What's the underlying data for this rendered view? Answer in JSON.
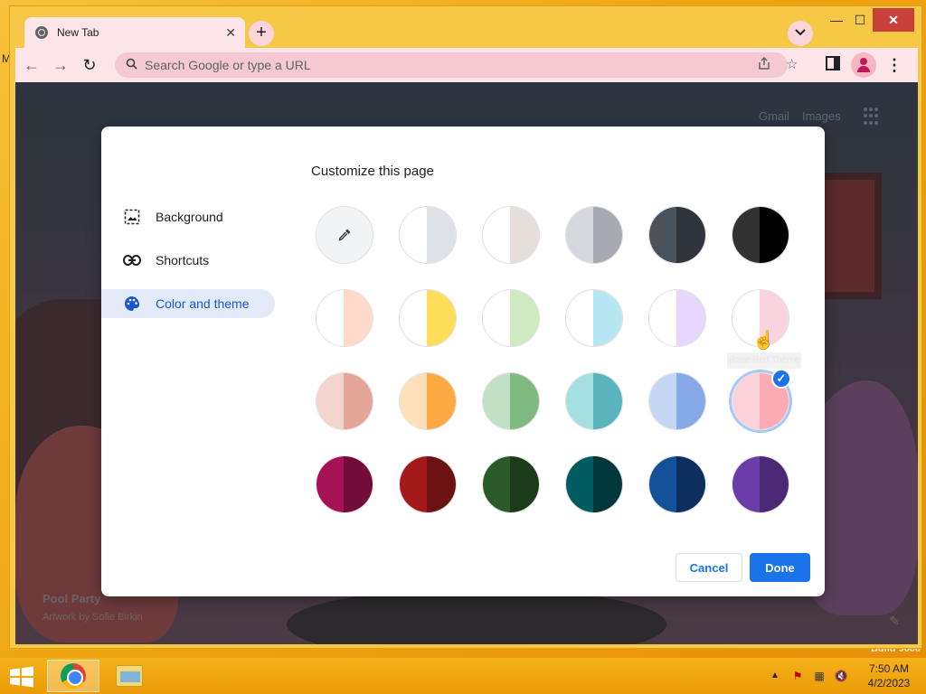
{
  "desktop": {
    "letter": "M",
    "build_text": "Build 9600"
  },
  "browser": {
    "tab": {
      "title": "New Tab",
      "close": "✕"
    },
    "newtab": "+",
    "window": {
      "minimize": "—",
      "maximize": "☐",
      "close": "✕"
    },
    "toolbar": {
      "back": "←",
      "forward": "→",
      "reload": "↻",
      "menu": "⋮"
    },
    "omnibox": {
      "placeholder": "Search Google or type a URL",
      "value": ""
    }
  },
  "ntp": {
    "links": {
      "gmail": "Gmail",
      "images": "Images"
    },
    "artwork": {
      "title": "Pool Party",
      "credit": "Artwork by Sofie Birkin"
    }
  },
  "dialog": {
    "title": "Customize this page",
    "sidebar": [
      {
        "label": "Background",
        "icon": "image-icon",
        "selected": false
      },
      {
        "label": "Shortcuts",
        "icon": "link-icon",
        "selected": false
      },
      {
        "label": "Color and theme",
        "icon": "palette-icon",
        "selected": true
      }
    ],
    "swatches": [
      [
        [
          "#f1f3f4",
          "#f1f3f4"
        ],
        [
          "#ffffff",
          "#dee1e6"
        ],
        [
          "#ffffff",
          "#e5dedb"
        ],
        [
          "#d5d7dc",
          "#a7aab1"
        ],
        [
          "#4a535c",
          "#2f353b"
        ],
        [
          "#323232",
          "#000000"
        ]
      ],
      [
        [
          "#ffffff",
          "#fddac9"
        ],
        [
          "#ffffff",
          "#fedd5b"
        ],
        [
          "#ffffff",
          "#cdeac2"
        ],
        [
          "#ffffff",
          "#b6e6f0"
        ],
        [
          "#ffffff",
          "#e7d6fd"
        ],
        [
          "#ffffff",
          "#fad3df"
        ]
      ],
      [
        [
          "#f2d4cc",
          "#e2a699"
        ],
        [
          "#fde0ba",
          "#fca843"
        ],
        [
          "#c2e0c6",
          "#7fbb81"
        ],
        [
          "#a6dfe1",
          "#5ab4be"
        ],
        [
          "#c6d7f4",
          "#86a9e7"
        ],
        [
          "#fdd2d8",
          "#fbaab6"
        ]
      ],
      [
        [
          "#a51253",
          "#720c36"
        ],
        [
          "#a41a1a",
          "#6d1212"
        ],
        [
          "#2b5a2a",
          "#1c3b1a"
        ],
        [
          "#035b62",
          "#00373c"
        ],
        [
          "#15509b",
          "#0c2f5e"
        ],
        [
          "#6b3da8",
          "#4a2a75"
        ]
      ]
    ],
    "selected_swatch": {
      "row": 2,
      "col": 5
    },
    "tooltip": "Rose Red Theme",
    "buttons": {
      "cancel": "Cancel",
      "done": "Done"
    },
    "accent": "#1a73e8"
  },
  "taskbar": {
    "apps": [
      "chrome-icon",
      "file-explorer-icon"
    ],
    "clock": {
      "time": "7:50 AM",
      "date": "4/2/2023"
    }
  }
}
